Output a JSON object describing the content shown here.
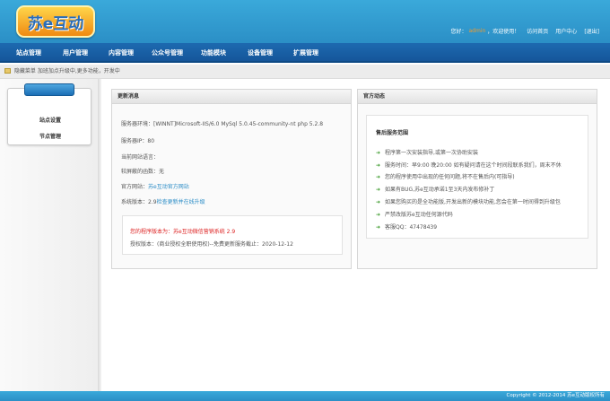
{
  "header": {
    "logo_text": "苏e互动",
    "greeting_prefix": "您好：",
    "username": "admin",
    "greeting_suffix": "，欢迎使用！",
    "links": [
      "访问首页",
      "用户中心",
      "[退出]"
    ]
  },
  "nav": {
    "items": [
      "站点管理",
      "用户管理",
      "内容管理",
      "公众号管理",
      "功能模块",
      "设备管理",
      "扩展管理"
    ]
  },
  "breadcrumb": {
    "text": "隐藏菜单 加班加点升级中,更多功能，开发中"
  },
  "sidebar": {
    "items": [
      "站点设置",
      "节点管理"
    ]
  },
  "update_panel": {
    "title": "更新消息",
    "server_env_label": "服务器环境：",
    "server_env_value": "[WINNT]Microsoft-IIS/6.0 MySql 5.0.45-community-nt php 5.2.8",
    "server_ip_label": "服务器IP：",
    "server_ip_value": "80",
    "site_lang_label": "当前网站语言：",
    "site_lang_value": "",
    "recovery_label": "较屏蔽的函数：",
    "recovery_value": "无",
    "official_label": "官方网站：",
    "official_link": "苏e互动官方网站",
    "version_label": "系统版本：",
    "version_value": "2.9",
    "version_link": "检查更新并在线升级",
    "program_version_label": "您的程序版本为：",
    "program_version_value": "苏e互动微信营销系统 2.9",
    "license_text": "授权版本：(商业授权全职使用权)--免费更新服务截止：2020-12-12"
  },
  "official_panel": {
    "title": "官方动态",
    "service_title": "售后服务范围",
    "items": [
      "程序第一次安装指导,或第一次协助安装",
      "服务时间：早9:00 晚20:00 如有疑问请在这个时间段联系我们，周末不休",
      "您的程序使用中出现的任何问题,将不在售后内(可指导)",
      "如果有BUG,苏e互动承诺1至3天内发布修补丁",
      "如果您购买的是全功能版,开发出新的模块功能,您会在第一时间得到升级包",
      "严禁改版苏e互动任何源代码",
      "客服QQ：47478439"
    ]
  },
  "footer": {
    "text": "Copyright © 2012-2014 苏e互动版权所有"
  },
  "colors": {
    "header_blue": "#2b8fc6",
    "nav_blue": "#15569a",
    "link_blue": "#2a8cc6",
    "warning_red": "#dd2222",
    "arrow_green": "#3a9a2a",
    "username_orange": "#f39a2b"
  }
}
